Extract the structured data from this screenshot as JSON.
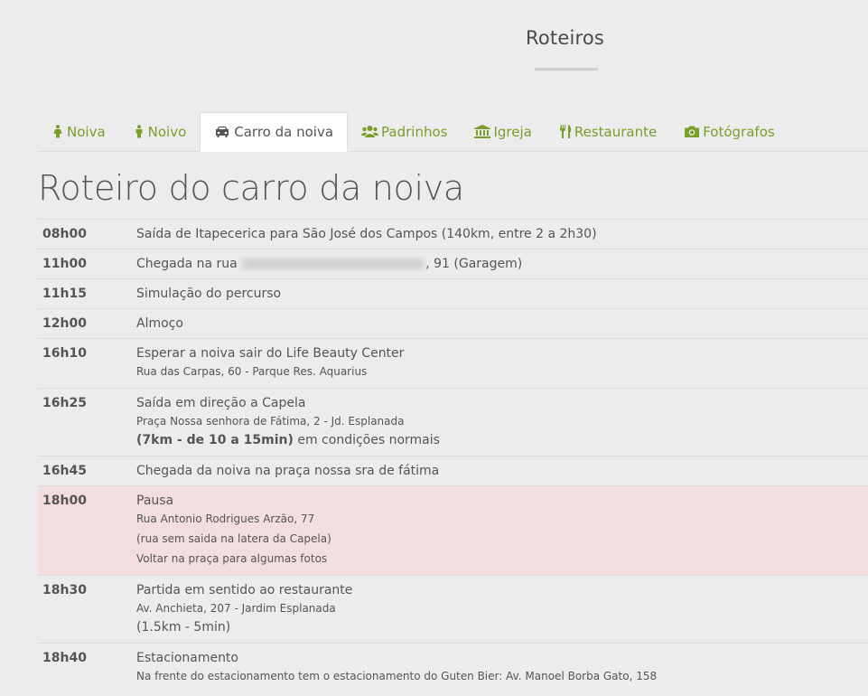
{
  "section": {
    "title": "Roteiros"
  },
  "tabs": [
    {
      "label": "Noiva",
      "icon": "female-icon"
    },
    {
      "label": "Noivo",
      "icon": "male-icon"
    },
    {
      "label": "Carro da noiva",
      "icon": "car-icon",
      "active": true
    },
    {
      "label": "Padrinhos",
      "icon": "users-icon"
    },
    {
      "label": "Igreja",
      "icon": "bank-icon"
    },
    {
      "label": "Restaurante",
      "icon": "cutlery-icon"
    },
    {
      "label": "Fotógrafos",
      "icon": "camera-icon"
    }
  ],
  "heading": "Roteiro do carro da noiva",
  "schedule": [
    {
      "time": "08h00",
      "text": "Saída de Itapecerica para São José dos Campos (140km, entre 2 a 2h30)"
    },
    {
      "time": "11h00",
      "text_before": "Chegada na rua",
      "text_after": ", 91 (Garagem)"
    },
    {
      "time": "11h15",
      "text": "Simulação do percurso"
    },
    {
      "time": "12h00",
      "text": "Almoço"
    },
    {
      "time": "16h10",
      "text": "Esperar a noiva sair do Life Beauty Center",
      "sub": [
        "Rua das Carpas, 60 - Parque Res. Aquarius"
      ]
    },
    {
      "time": "16h25",
      "text": "Saída em direção a Capela",
      "sub": [
        "Praça Nossa senhora de Fátima, 2 - Jd. Esplanada"
      ],
      "note_bold": "(7km - de 10 a 15min)",
      "note_rest": " em condições normais"
    },
    {
      "time": "16h45",
      "text": "Chegada da noiva na praça nossa sra de fátima"
    },
    {
      "time": "18h00",
      "text": "Pausa",
      "sub": [
        "Rua Antonio Rodrigues Arzão, 77",
        "(rua sem saida na latera da Capela)",
        "Voltar na praça para algumas fotos"
      ],
      "highlight": true
    },
    {
      "time": "18h30",
      "text": "Partida em sentido ao restaurante",
      "sub": [
        "Av. Anchieta, 207 - Jardim Esplanada"
      ],
      "note": "(1.5km - 5min)"
    },
    {
      "time": "18h40",
      "text": "Estacionamento",
      "sub": [
        "Na frente do estacionamento tem o estacionamento do Guten Bier: Av. Manoel Borba Gato, 158"
      ]
    }
  ],
  "colors": {
    "accent": "#7a9e2a",
    "highlight_row": "#f2dede",
    "background": "#ececec"
  }
}
